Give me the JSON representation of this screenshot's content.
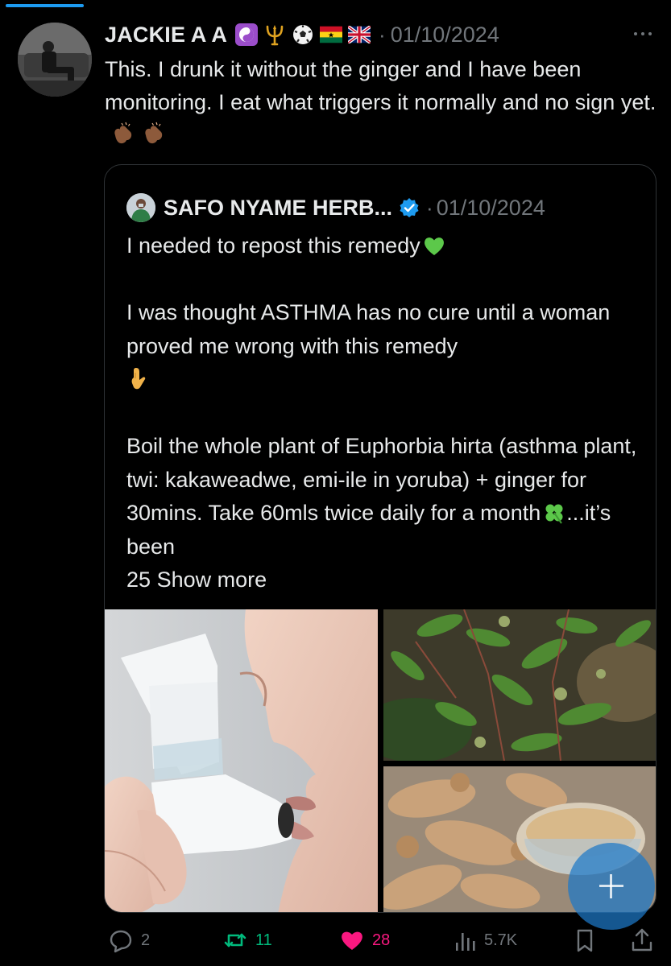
{
  "tweet": {
    "author_name": "JACKIE A A",
    "badges": [
      "yin-yang-icon",
      "trident-icon",
      "soccer-ball-icon",
      "ghana-flag-icon",
      "uk-flag-icon"
    ],
    "date_separator": "·",
    "date": "01/10/2024",
    "text": "This. I drunk it without the ginger and I have been monitoring. I eat what triggers it normally and no sign yet.",
    "trailing_emoji": [
      "clapping-hands-icon",
      "clapping-hands-icon"
    ]
  },
  "quote": {
    "author_name": "SAFO NYAME HERB...",
    "verified": true,
    "date_separator": "·",
    "date": "01/10/2024",
    "line1": "I needed to repost this remedy",
    "line1_emoji": "green-heart-icon",
    "para2": "I was thought ASTHMA has no cure until a woman proved me wrong with this remedy",
    "para2_emoji": "pointing-down-icon",
    "para3": "Boil the whole plant of Euphorbia hirta (asthma plant, twi: kakaweadwe, emi-ile in yoruba) + ginger for 30mins. Take 60mls twice daily for a month",
    "para3_emoji": "four-leaf-clover-icon",
    "para3_tail": "...it’s been",
    "para3_last": "25",
    "show_more": "Show more",
    "images": [
      "inhaler-photo",
      "euphorbia-hirta-plant-photo",
      "ginger-and-powder-photo"
    ]
  },
  "actions": {
    "replies": "2",
    "reposts": "11",
    "likes": "28",
    "views": "5.7K"
  },
  "colors": {
    "background": "#000000",
    "text": "#e7e9ea",
    "muted": "#71767b",
    "accent": "#1d9bf0",
    "repost": "#00ba7c",
    "like": "#f91880"
  }
}
